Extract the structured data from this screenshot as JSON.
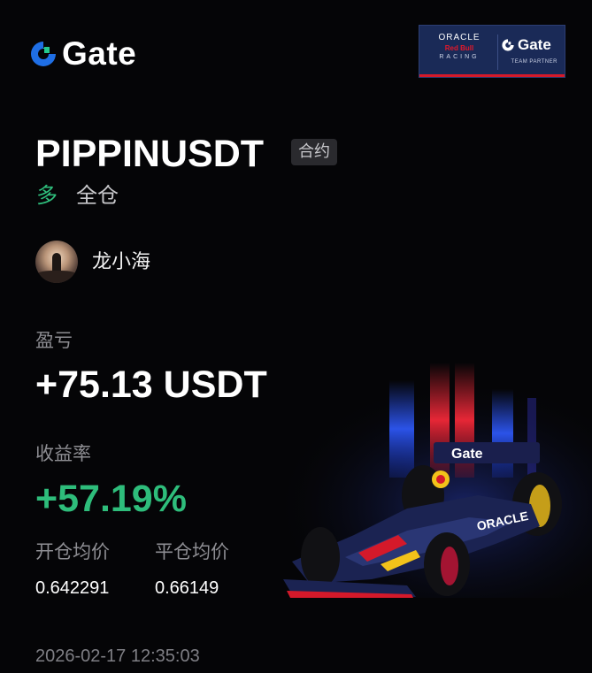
{
  "brand": {
    "logo_text": "Gate",
    "logo_color": "#1f6fe5"
  },
  "partner_badge": {
    "oracle": "ORACLE",
    "red_bull": "Red Bull",
    "racing": "RACING",
    "gate": "Gate",
    "team_partner": "TEAM PARTNER"
  },
  "position": {
    "pair": "PIPPINUSDT",
    "contract_tag": "合约",
    "direction": "多",
    "margin_mode": "全仓"
  },
  "user": {
    "name": "龙小海"
  },
  "pnl": {
    "label": "盈亏",
    "value": "+75.13 USDT"
  },
  "roi": {
    "label": "收益率",
    "value": "+57.19%"
  },
  "prices": {
    "open_label": "开仓均价",
    "close_label": "平仓均价",
    "open_value": "0.642291",
    "close_value": "0.66149"
  },
  "timestamp": "2026-02-17 12:35:03",
  "colors": {
    "background": "#050507",
    "positive": "#2ebd7b",
    "muted_text": "#8e8e93"
  },
  "artwork": {
    "car_wing_text": "Gate",
    "car_sidepod_text": "ORACLE"
  }
}
